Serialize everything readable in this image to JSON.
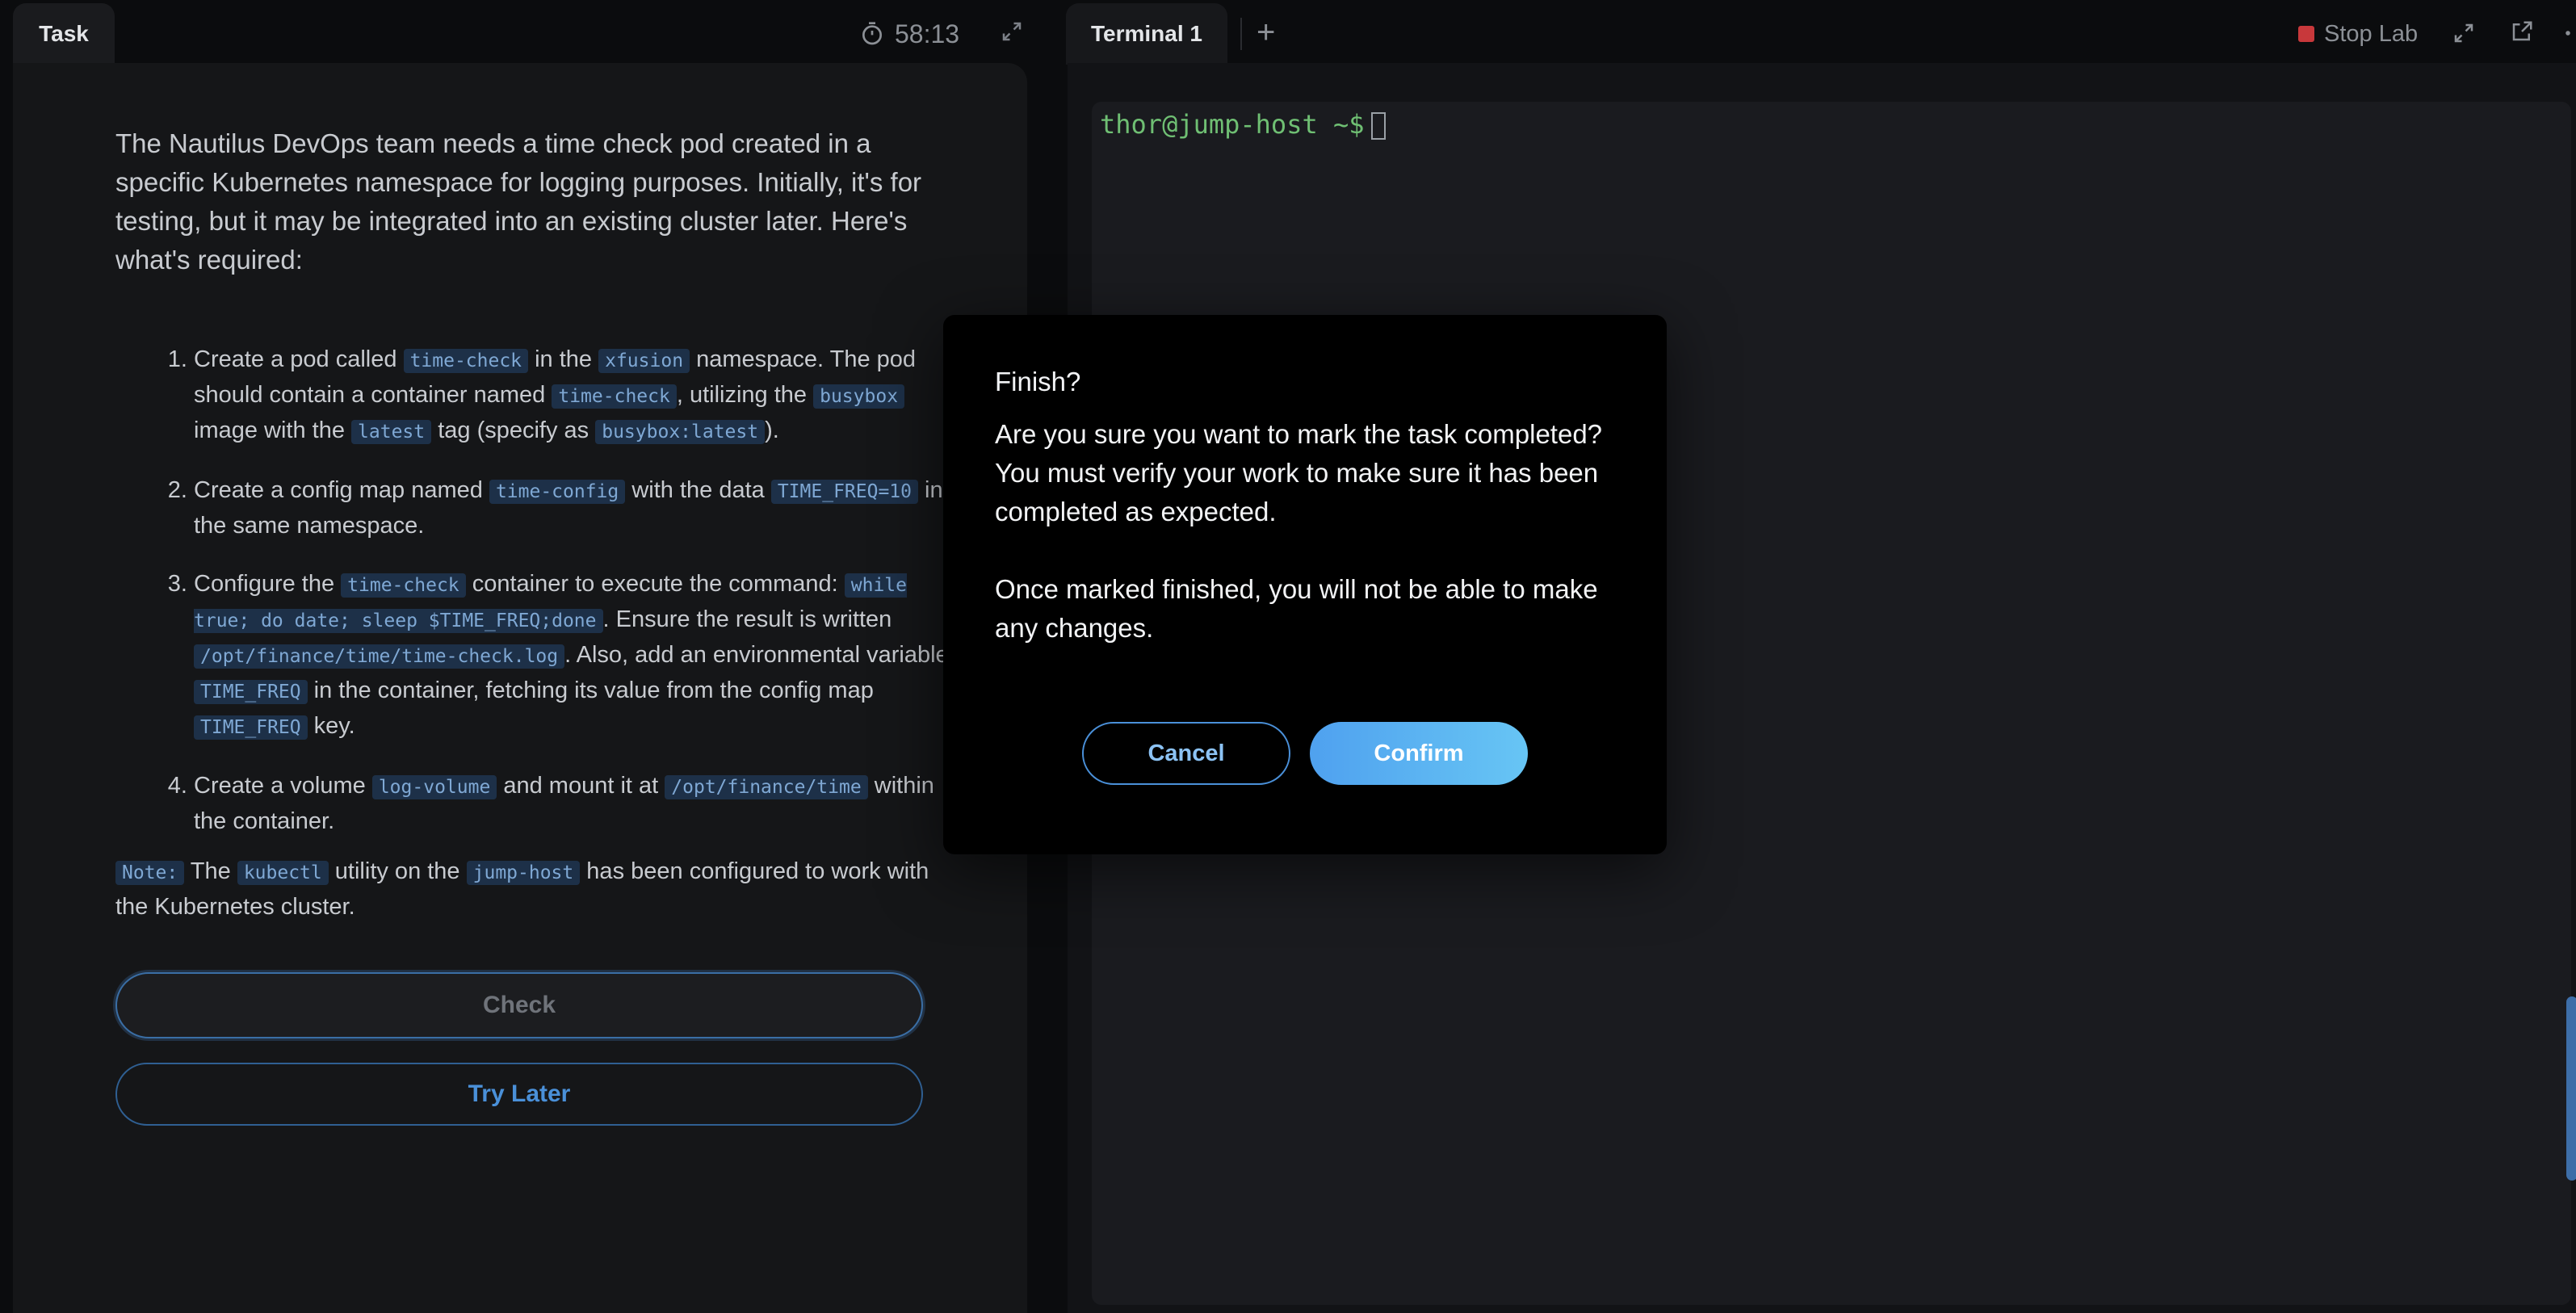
{
  "task_panel": {
    "tab_label": "Task",
    "timer": "58:13",
    "intro": "The Nautilus DevOps team needs a time check pod created in a specific Kubernetes namespace for logging purposes. Initially, it's for testing, but it may be integrated into an existing cluster later. Here's what's required:",
    "steps": [
      {
        "t1": "Create a pod called ",
        "c1": "time-check",
        "t2": " in the ",
        "c2": "xfusion",
        "t3": " namespace. The pod should contain a container named ",
        "c3": "time-check",
        "t4": ", utilizing the ",
        "c4": "busybox",
        "t5": " image with the ",
        "c5": "latest",
        "t6": " tag (specify as ",
        "c6": "busybox:latest",
        "t7": ")."
      },
      {
        "t1": "Create a config map named ",
        "c1": "time-config",
        "t2": " with the data ",
        "c2": "TIME_FREQ=10",
        "t3": " in the same namespace."
      },
      {
        "t1": "Configure the ",
        "c1": "time-check",
        "t2": " container to execute the command: ",
        "c2": "while true; do date; sleep $TIME_FREQ;done",
        "t3": ". Ensure the result is written ",
        "c3": "/opt/finance/time/time-check.log",
        "t4": ". Also, add an environmental variable ",
        "c4": "TIME_FREQ",
        "t5": " in the container, fetching its value from the config map ",
        "c5": "TIME_FREQ",
        "t6": " key."
      },
      {
        "t1": "Create a volume ",
        "c1": "log-volume",
        "t2": " and mount it at ",
        "c2": "/opt/finance/time",
        "t3": " within the container."
      }
    ],
    "note": {
      "label": "Note:",
      "t1": " The ",
      "c1": "kubectl",
      "t2": " utility on the ",
      "c2": "jump-host",
      "t3": " has been configured to work with the Kubernetes cluster."
    },
    "check_label": "Check",
    "try_later_label": "Try Later"
  },
  "terminal": {
    "tab_label": "Terminal 1",
    "add_tab": "+",
    "stop_lab_label": "Stop Lab",
    "prompt": "thor@jump-host ~$"
  },
  "modal": {
    "title": "Finish?",
    "body1": "Are you sure you want to mark the task completed? You must verify your work to make sure it has been completed as expected.",
    "body2": "Once marked finished, you will not be able to make any changes.",
    "cancel_label": "Cancel",
    "confirm_label": "Confirm"
  },
  "colors": {
    "accent": "#4a90d9",
    "prompt_green": "#6fbf73",
    "stop_red": "#c8383b"
  }
}
